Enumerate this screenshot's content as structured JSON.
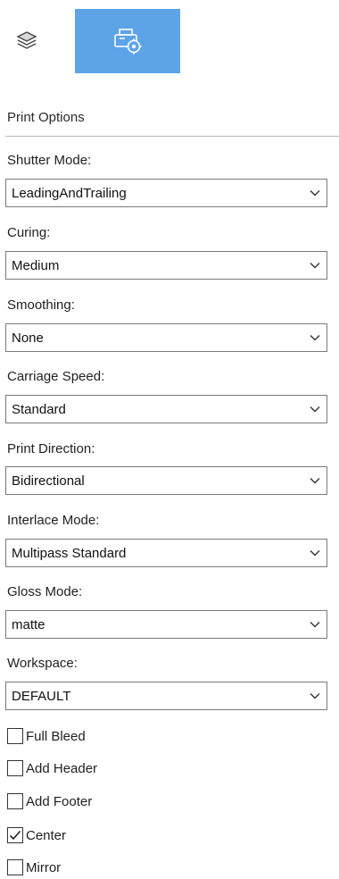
{
  "tabs": [
    {
      "icon": "layers-icon",
      "active": false
    },
    {
      "icon": "printer-settings-icon",
      "active": true
    }
  ],
  "section_title": "Print Options",
  "fields": [
    {
      "label": "Shutter Mode:",
      "value": "LeadingAndTrailing"
    },
    {
      "label": "Curing:",
      "value": "Medium"
    },
    {
      "label": "Smoothing:",
      "value": "None"
    },
    {
      "label": "Carriage Speed:",
      "value": "Standard"
    },
    {
      "label": "Print Direction:",
      "value": "Bidirectional"
    },
    {
      "label": "Interlace Mode:",
      "value": "Multipass Standard"
    },
    {
      "label": "Gloss Mode:",
      "value": "matte"
    },
    {
      "label": "Workspace:",
      "value": "DEFAULT"
    }
  ],
  "checkboxes": [
    {
      "label": "Full Bleed",
      "checked": false
    },
    {
      "label": "Add Header",
      "checked": false
    },
    {
      "label": "Add Footer",
      "checked": false
    },
    {
      "label": "Center",
      "checked": true
    },
    {
      "label": "Mirror",
      "checked": false
    }
  ],
  "colors": {
    "active_tab": "#5da3e8",
    "border": "#7a7a7a"
  }
}
